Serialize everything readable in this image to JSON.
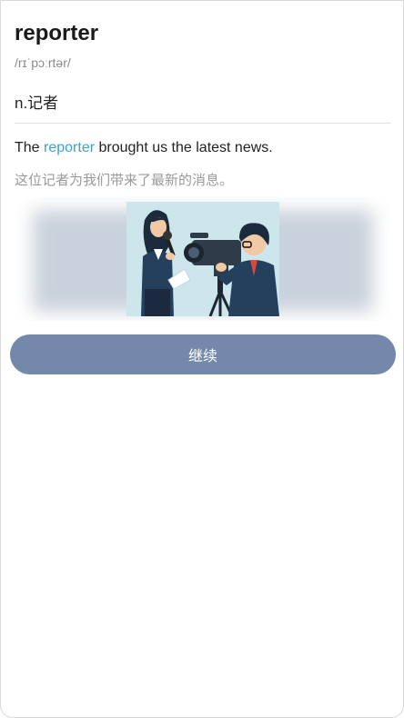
{
  "word": "reporter",
  "phonetic": "/rɪˈpɔːrtər/",
  "definition": "n.记者",
  "example": {
    "before": "The ",
    "highlight": "reporter",
    "after": " brought us the latest news.",
    "translation": "这位记者为我们带来了最新的消息。"
  },
  "illustration": {
    "icon": "reporter-camera-illustration"
  },
  "continue_label": "继续",
  "colors": {
    "highlight": "#3aa3d0",
    "button": "#7388ab",
    "illustration_bg": "#cce6ec"
  }
}
